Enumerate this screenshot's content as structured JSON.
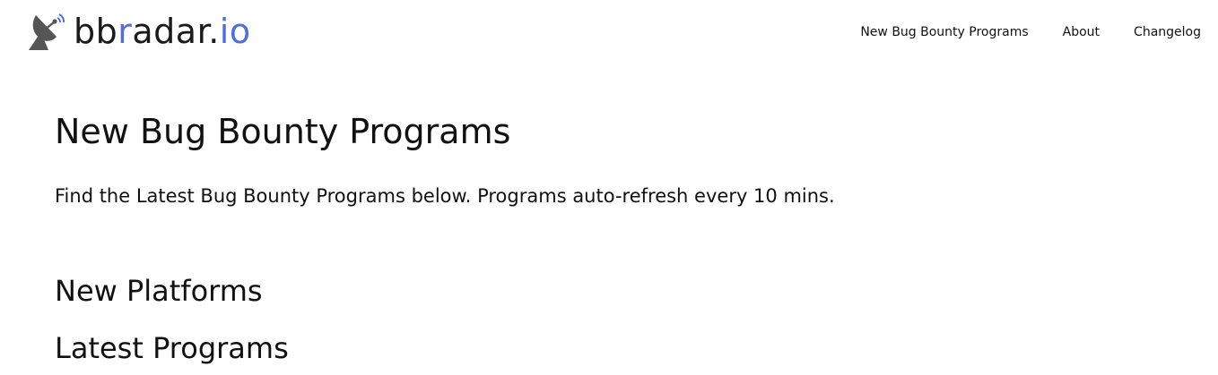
{
  "brand": {
    "prefix": "bb",
    "accent": "r",
    "suffix": "adar.",
    "accent2": "io",
    "accent_color": "#4f6fe0",
    "icon": "satellite-dish-icon"
  },
  "nav": {
    "items": [
      {
        "label": "New Bug Bounty Programs"
      },
      {
        "label": "About"
      },
      {
        "label": "Changelog"
      }
    ]
  },
  "main": {
    "title": "New Bug Bounty Programs",
    "description": "Find the Latest Bug Bounty Programs below. Programs auto-refresh every 10 mins.",
    "sections": [
      {
        "title": "New Platforms"
      },
      {
        "title": "Latest Programs"
      }
    ]
  }
}
